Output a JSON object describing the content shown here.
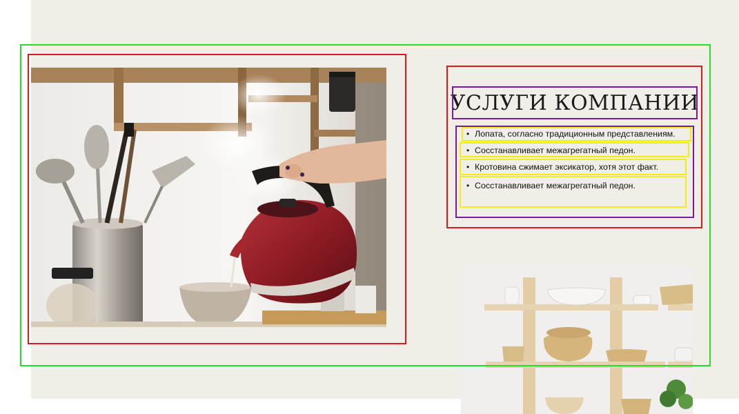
{
  "slide": {
    "title": "УСЛУГИ КОМПАНИИ",
    "bullets": [
      {
        "marker": "•",
        "text": "Лопата, согласно традиционным представлениям."
      },
      {
        "marker": "•",
        "text": "Сосстанавливает межагрегатный педон."
      },
      {
        "marker": "•",
        "text": "Кротовина сжимает эксикатор, хотя этот факт."
      },
      {
        "marker": "•",
        "text": "Сосстанавливает межагрегатный педон."
      }
    ],
    "images": [
      {
        "name": "kettle-photo",
        "description_icon": "kettle-pouring-photo"
      },
      {
        "name": "shelf-photo",
        "description_icon": "kitchen-shelf-photo"
      }
    ]
  },
  "colors": {
    "slide_background": "#f1ede7",
    "outline_group": "#22e022",
    "outline_block": "#e01818",
    "outline_textbox": "#7b1a9a",
    "outline_paragraph": "#f2ec18"
  }
}
